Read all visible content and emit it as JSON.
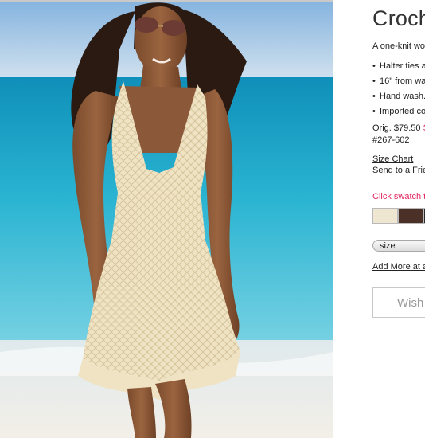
{
  "product": {
    "title": "Croch",
    "description": "A one-knit wo",
    "bullets": [
      "Halter ties a",
      "16\" from wa",
      "Hand wash.",
      "Imported co"
    ],
    "price_orig": "Orig. $79.50",
    "price_sale": "S",
    "item_number": "#267-602",
    "size_chart_link": "Size Chart",
    "send_friend_link": "Send to a Frie",
    "swatch_prompt": "Click swatch t",
    "swatches": [
      {
        "name": "cream-swatch",
        "color": "#efe6d2"
      },
      {
        "name": "brown-swatch",
        "color": "#4a3026"
      },
      {
        "name": "dark-swatch",
        "color": "#2a2a2a"
      }
    ],
    "size_label": "size",
    "add_more_link": "Add More at a",
    "wish_button": "Wish"
  },
  "colors": {
    "sale": "#e0245e",
    "sky": "#a9c8e4",
    "sea": "#1fa6c8",
    "sand": "#f0ebe2",
    "dress": "#efe3c4"
  }
}
